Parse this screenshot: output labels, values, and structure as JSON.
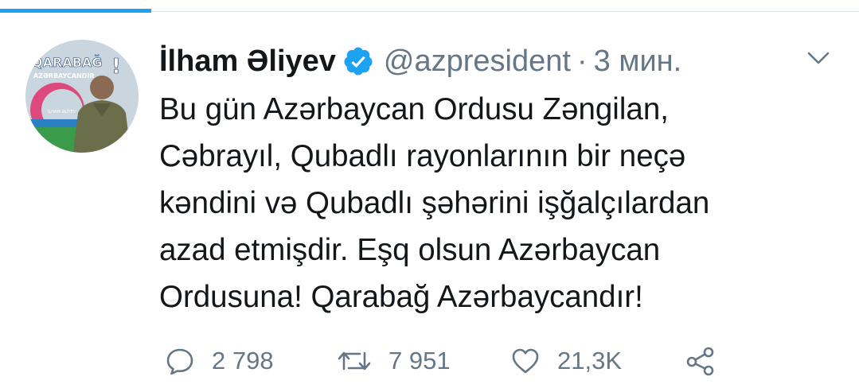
{
  "tweet": {
    "display_name": "İlham Əliyev",
    "handle": "@azpresident",
    "separator": "·",
    "timestamp": "3 мин.",
    "text": "Bu gün Azərbaycan Ordusu Zəngilan,\nCəbrayıl, Qubadlı rayonlarının bir neçə\nkəndini və Qubadlı şəhərini işğalçılardan\nazad etmişdir. Eşq olsun Azərbaycan\nOrdusuna! Qarabağ Azərbaycandır!",
    "avatar": {
      "banner_text": "QARABAĞ",
      "banner_subtext": "AZƏRBAYCANDIR",
      "exclamation": "!",
      "caption": "İLHAM ƏLİYEV"
    }
  },
  "actions": {
    "reply_count": "2 798",
    "retweet_count": "7 951",
    "like_count": "21,3K"
  },
  "icons": {
    "verified": "verified-badge-icon",
    "caret": "chevron-down-icon",
    "reply": "comment-bubble-icon",
    "retweet": "retweet-arrows-icon",
    "like": "heart-icon",
    "share": "share-icon"
  },
  "colors": {
    "accent": "#1da1f2",
    "text_primary": "#14171a",
    "text_secondary": "#657786"
  }
}
